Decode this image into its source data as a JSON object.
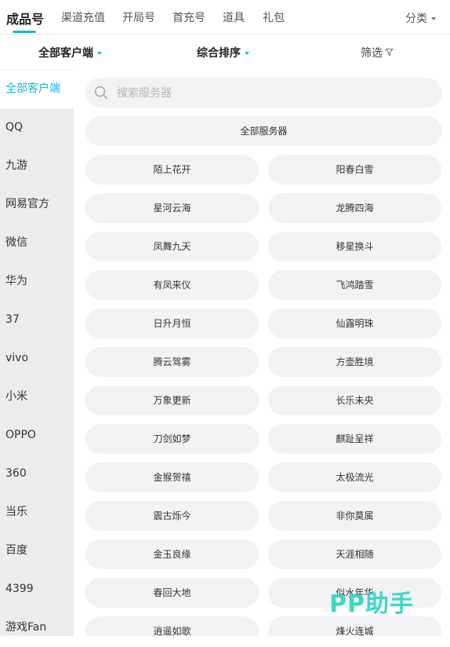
{
  "tabs": [
    {
      "label": "成品号",
      "active": true
    },
    {
      "label": "渠道充值"
    },
    {
      "label": "开局号"
    },
    {
      "label": "首充号"
    },
    {
      "label": "道具"
    },
    {
      "label": "礼包"
    }
  ],
  "category_label": "分类",
  "filters": {
    "client": "全部客户端",
    "sort": "综合排序",
    "screen": "筛选"
  },
  "sidebar": [
    "全部客户端",
    "QQ",
    "九游",
    "网易官方",
    "微信",
    "华为",
    "37",
    "vivo",
    "小米",
    "OPPO",
    "360",
    "当乐",
    "百度",
    "4399",
    "游戏Fan"
  ],
  "search": {
    "placeholder": "搜索服务器"
  },
  "all_servers_label": "全部服务器",
  "servers": [
    [
      "陌上花开",
      "阳春白雪"
    ],
    [
      "星河云海",
      "龙腾四海"
    ],
    [
      "凤舞九天",
      "移星换斗"
    ],
    [
      "有凤来仪",
      "飞鸿踏雪"
    ],
    [
      "日升月恒",
      "仙露明珠"
    ],
    [
      "腾云驾雾",
      "方壶胜境"
    ],
    [
      "万象更新",
      "长乐未央"
    ],
    [
      "刀剑如梦",
      "麒趾呈祥"
    ],
    [
      "金猴贺禧",
      "太极流光"
    ],
    [
      "震古烁今",
      "非你莫属"
    ],
    [
      "金玉良缘",
      "天涯相随"
    ],
    [
      "春回大地",
      "似水年华"
    ],
    [
      "逍遥如歌",
      "烽火连城"
    ]
  ],
  "watermark": "PP助手",
  "colors": {
    "accent": "#1cb5d8",
    "sidebar_bg": "#ececec",
    "pill_bg": "#f1f2f4",
    "watermark": "#33d6c4"
  }
}
